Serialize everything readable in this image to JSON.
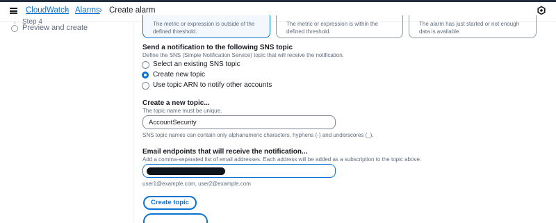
{
  "breadcrumb": {
    "items": [
      "CloudWatch",
      "Alarms",
      "Create alarm"
    ]
  },
  "steps": {
    "cut_label": "Step 4",
    "preview_label": "Preview and create"
  },
  "threshold_tiles": [
    {
      "text": "The metric or expression is outside of the defined threshold.",
      "selected": true
    },
    {
      "text": "The metric or expression is within the defined threshold.",
      "selected": false
    },
    {
      "text": "The alarm has just started or not enough data is available.",
      "selected": false
    }
  ],
  "sns": {
    "heading": "Send a notification to the following SNS topic",
    "description": "Define the SNS (Simple Notification Service) topic that will receive the notification.",
    "options": [
      {
        "label": "Select an existing SNS topic",
        "checked": false
      },
      {
        "label": "Create new topic",
        "checked": true
      },
      {
        "label": "Use topic ARN to notify other accounts",
        "checked": false
      }
    ]
  },
  "new_topic": {
    "heading": "Create a new topic...",
    "description": "The topic name must be unique.",
    "value": "AccountSecurity",
    "constraint": "SNS topic names can contain only alphanumeric characters, hyphens (-) and underscores (_)."
  },
  "endpoints": {
    "heading": "Email endpoints that will receive the notification...",
    "description": "Add a comma-separated list of email addresses. Each address will be added as a subscription to the topic above.",
    "value": "",
    "hint": "user1@example.com, user2@example.com"
  },
  "create_topic_button": "Create topic",
  "colors": {
    "accent": "#0972d3",
    "text": "#16191f",
    "secondary_text": "#5f6b7a"
  }
}
